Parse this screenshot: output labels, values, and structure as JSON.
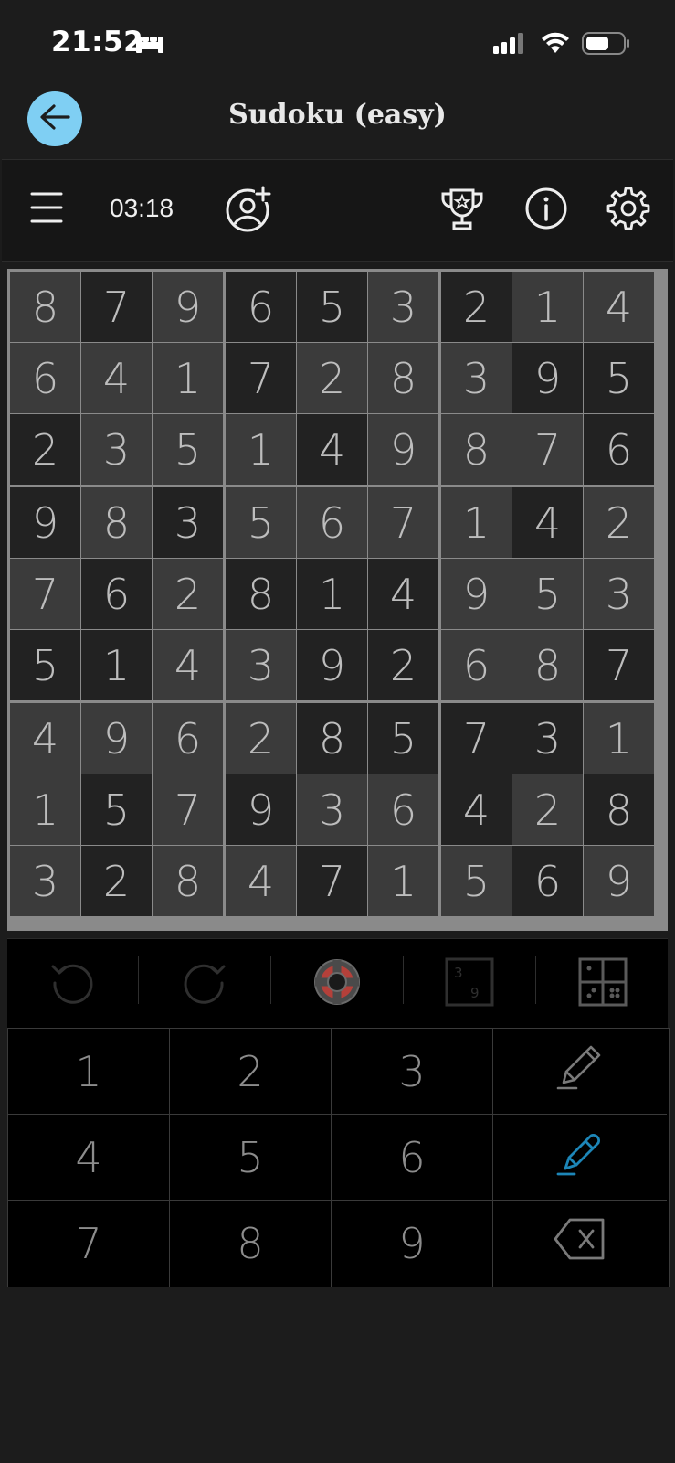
{
  "status": {
    "time": "21:52"
  },
  "header": {
    "title": "Sudoku (easy)"
  },
  "toolbar": {
    "timer": "03:18"
  },
  "grid": {
    "rows": [
      [
        "8",
        "7",
        "9",
        "6",
        "5",
        "3",
        "2",
        "1",
        "4"
      ],
      [
        "6",
        "4",
        "1",
        "7",
        "2",
        "8",
        "3",
        "9",
        "5"
      ],
      [
        "2",
        "3",
        "5",
        "1",
        "4",
        "9",
        "8",
        "7",
        "6"
      ],
      [
        "9",
        "8",
        "3",
        "5",
        "6",
        "7",
        "1",
        "4",
        "2"
      ],
      [
        "7",
        "6",
        "2",
        "8",
        "1",
        "4",
        "9",
        "5",
        "3"
      ],
      [
        "5",
        "1",
        "4",
        "3",
        "9",
        "2",
        "6",
        "8",
        "7"
      ],
      [
        "4",
        "9",
        "6",
        "2",
        "8",
        "5",
        "7",
        "3",
        "1"
      ],
      [
        "1",
        "5",
        "7",
        "9",
        "3",
        "6",
        "4",
        "2",
        "8"
      ],
      [
        "3",
        "2",
        "8",
        "4",
        "7",
        "1",
        "5",
        "6",
        "9"
      ]
    ],
    "shades": [
      "LDLDDLDLL",
      "LLLDLLLDD",
      "DLLLDLLLD",
      "DLDLLLLDL",
      "LDLDDDLLL",
      "DDLLDDLLD",
      "LLLLDDDDL",
      "LDLDLLDLD",
      "LDLLDLLDL"
    ]
  },
  "actions": {
    "items": [
      "undo-icon",
      "redo-icon",
      "hint-lifebuoy-icon",
      "notes-number-icon",
      "grid-layout-icon"
    ]
  },
  "keypad": {
    "keys": [
      "1",
      "2",
      "3",
      "pencil-icon",
      "4",
      "5",
      "6",
      "pen-icon",
      "7",
      "8",
      "9",
      "backspace-icon"
    ]
  },
  "colors": {
    "accent": "#7fcff3",
    "pen_active": "#1d86b8",
    "lifebuoy": "#b4403a"
  }
}
